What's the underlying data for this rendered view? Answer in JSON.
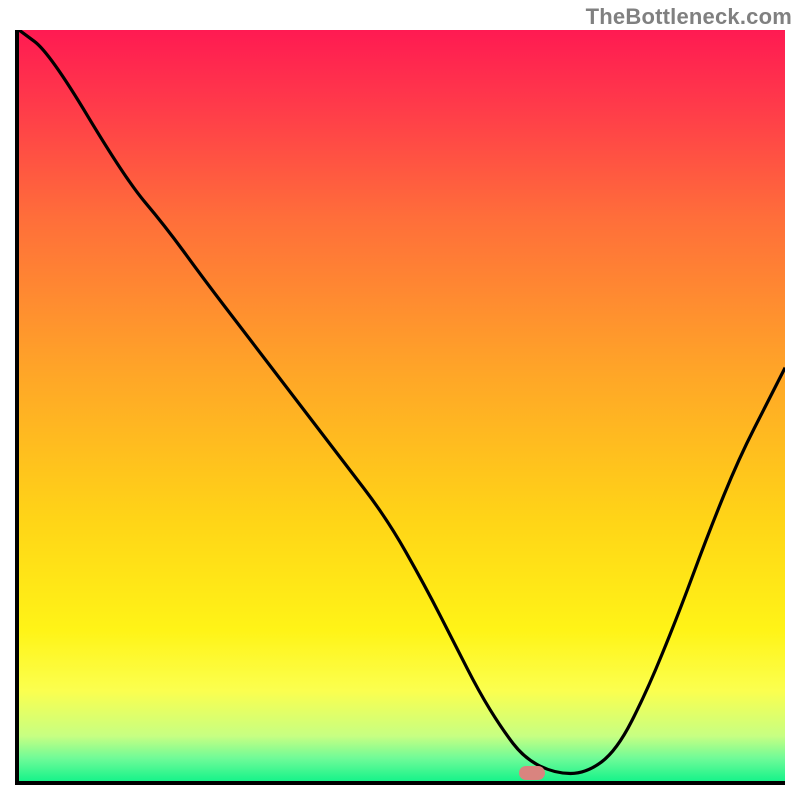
{
  "watermark": "TheBottleneck.com",
  "chart_data": {
    "type": "line",
    "title": "",
    "xlabel": "",
    "ylabel": "",
    "xlim": [
      0,
      100
    ],
    "ylim": [
      0,
      100
    ],
    "grid": false,
    "line_color": "#000000",
    "background_gradient": [
      "#ff1a52",
      "#ff6e3a",
      "#ffd417",
      "#fbff4f",
      "#17f38a"
    ],
    "series": [
      {
        "name": "curve",
        "x": [
          0,
          4,
          14,
          19,
          24,
          30,
          36,
          42,
          48,
          53,
          57,
          60,
          63,
          66,
          70,
          74,
          78,
          82,
          86,
          90,
          94,
          98,
          100
        ],
        "y": [
          100,
          97,
          80,
          74,
          67,
          59,
          51,
          43,
          35,
          26,
          18,
          12,
          7,
          3,
          1,
          1,
          4,
          12,
          22,
          33,
          43,
          51,
          55
        ]
      }
    ],
    "marker": {
      "x": 67,
      "y": 1,
      "color": "#d9847f"
    }
  }
}
